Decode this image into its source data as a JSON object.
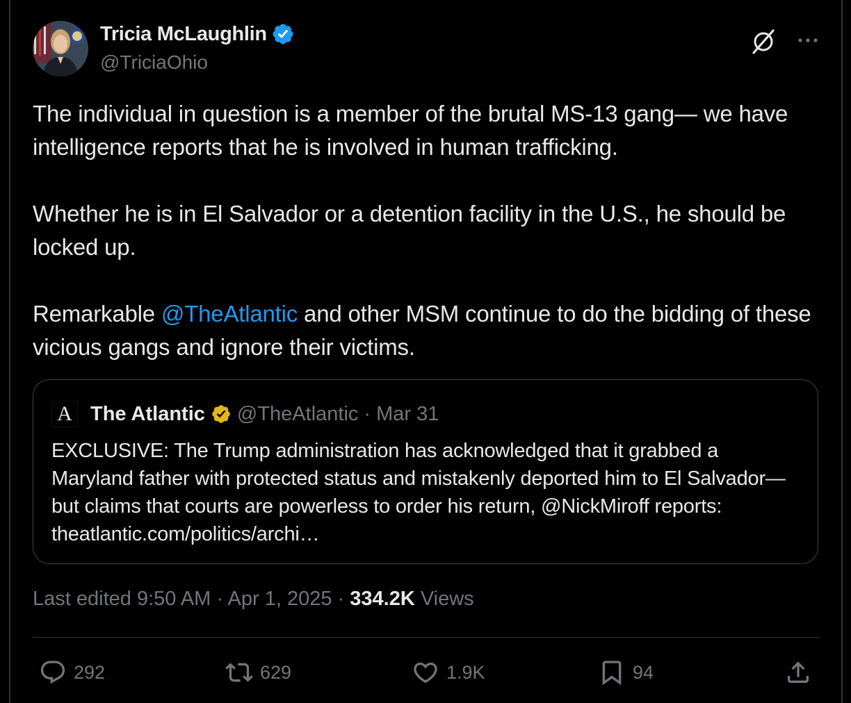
{
  "author": {
    "name": "Tricia McLaughlin",
    "handle": "@TriciaOhio",
    "verified": true,
    "avatar_icon": "avatar-photo"
  },
  "header_icons": {
    "grok": "grok-icon",
    "more": "more-icon"
  },
  "tweet": {
    "paragraphs": [
      {
        "text": "The individual in question is a member of the brutal MS-13 gang— we have intelligence reports that he is involved in human trafficking."
      },
      {
        "text": "Whether he is in El Salvador or a detention facility in the U.S., he should be locked up."
      },
      {
        "pre": "Remarkable ",
        "mention": "@TheAtlantic",
        "post": " and other MSM continue to do the bidding of these vicious gangs and ignore their victims."
      }
    ]
  },
  "quote": {
    "logo_letter": "A",
    "name": "The Atlantic",
    "verified": true,
    "handle": "@TheAtlantic",
    "separator": "·",
    "date": "Mar 31",
    "text": "EXCLUSIVE: The Trump administration has acknowledged that it grabbed a Maryland father with protected status and mistakenly deported him to El Salvador—but claims that courts are powerless to order his return, @NickMiroff reports: theatlantic.com/politics/archi…"
  },
  "meta": {
    "edited": "Last edited 9:50 AM",
    "sep1": " · ",
    "date": "Apr 1, 2025",
    "sep2": " · ",
    "views_count": "334.2K",
    "views_label": " Views"
  },
  "actions": {
    "replies": "292",
    "reposts": "629",
    "likes": "1.9K",
    "bookmarks": "94"
  },
  "colors": {
    "background": "#000000",
    "text": "#e7e9ea",
    "secondary": "#71767b",
    "link": "#1d9bf0",
    "verified_blue": "#1d9bf0",
    "verified_gold": "#e2b719"
  }
}
